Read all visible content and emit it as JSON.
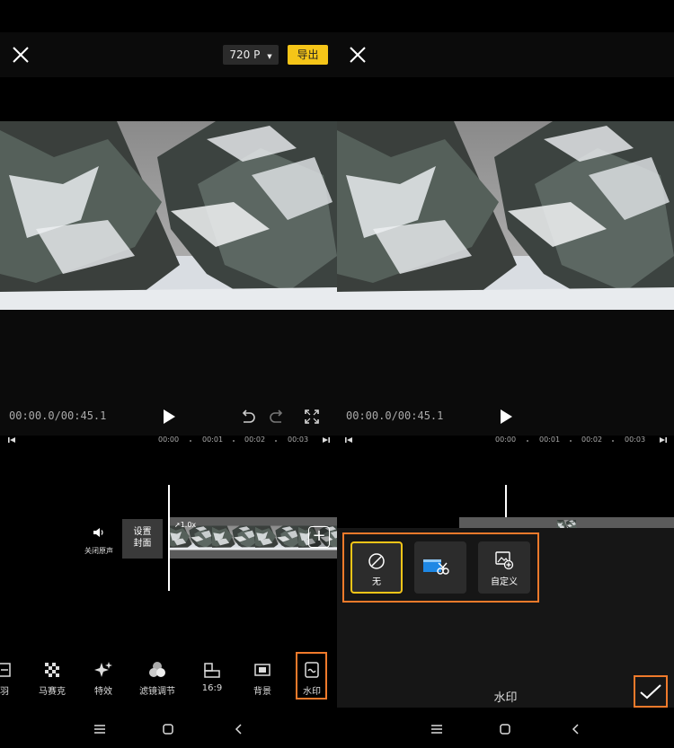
{
  "left_panel": {
    "resolution": "720 P",
    "export_label": "导出",
    "timecode": "00:00.0/00:45.1",
    "ruler_ticks": [
      "00:00",
      "00:01",
      "00:02",
      "00:03"
    ],
    "mute_label": "关闭原声",
    "cover_label": "设置\n封面",
    "clip_speed": "1.0x",
    "tools": [
      {
        "label": "羽",
        "icon": "partial-icon"
      },
      {
        "label": "马赛克",
        "icon": "mosaic-icon"
      },
      {
        "label": "特效",
        "icon": "sparkle-icon"
      },
      {
        "label": "滤镜调节",
        "icon": "filter-icon"
      },
      {
        "label": "16:9",
        "icon": "aspect-ratio-icon"
      },
      {
        "label": "背景",
        "icon": "background-icon"
      },
      {
        "label": "水印",
        "icon": "watermark-icon"
      }
    ]
  },
  "right_panel": {
    "timecode": "00:00.0/00:45.1",
    "ruler_ticks": [
      "00:00",
      "00:01",
      "00:02",
      "00:03"
    ],
    "watermark_options": [
      {
        "label": "无",
        "icon": "none-icon"
      },
      {
        "label": "",
        "icon": "clapper-scissors-logo-icon"
      },
      {
        "label": "自定义",
        "icon": "custom-image-icon"
      }
    ],
    "panel_title": "水印"
  },
  "colors": {
    "accent_yellow": "#f5c518",
    "highlight_orange": "#f07a2b"
  }
}
